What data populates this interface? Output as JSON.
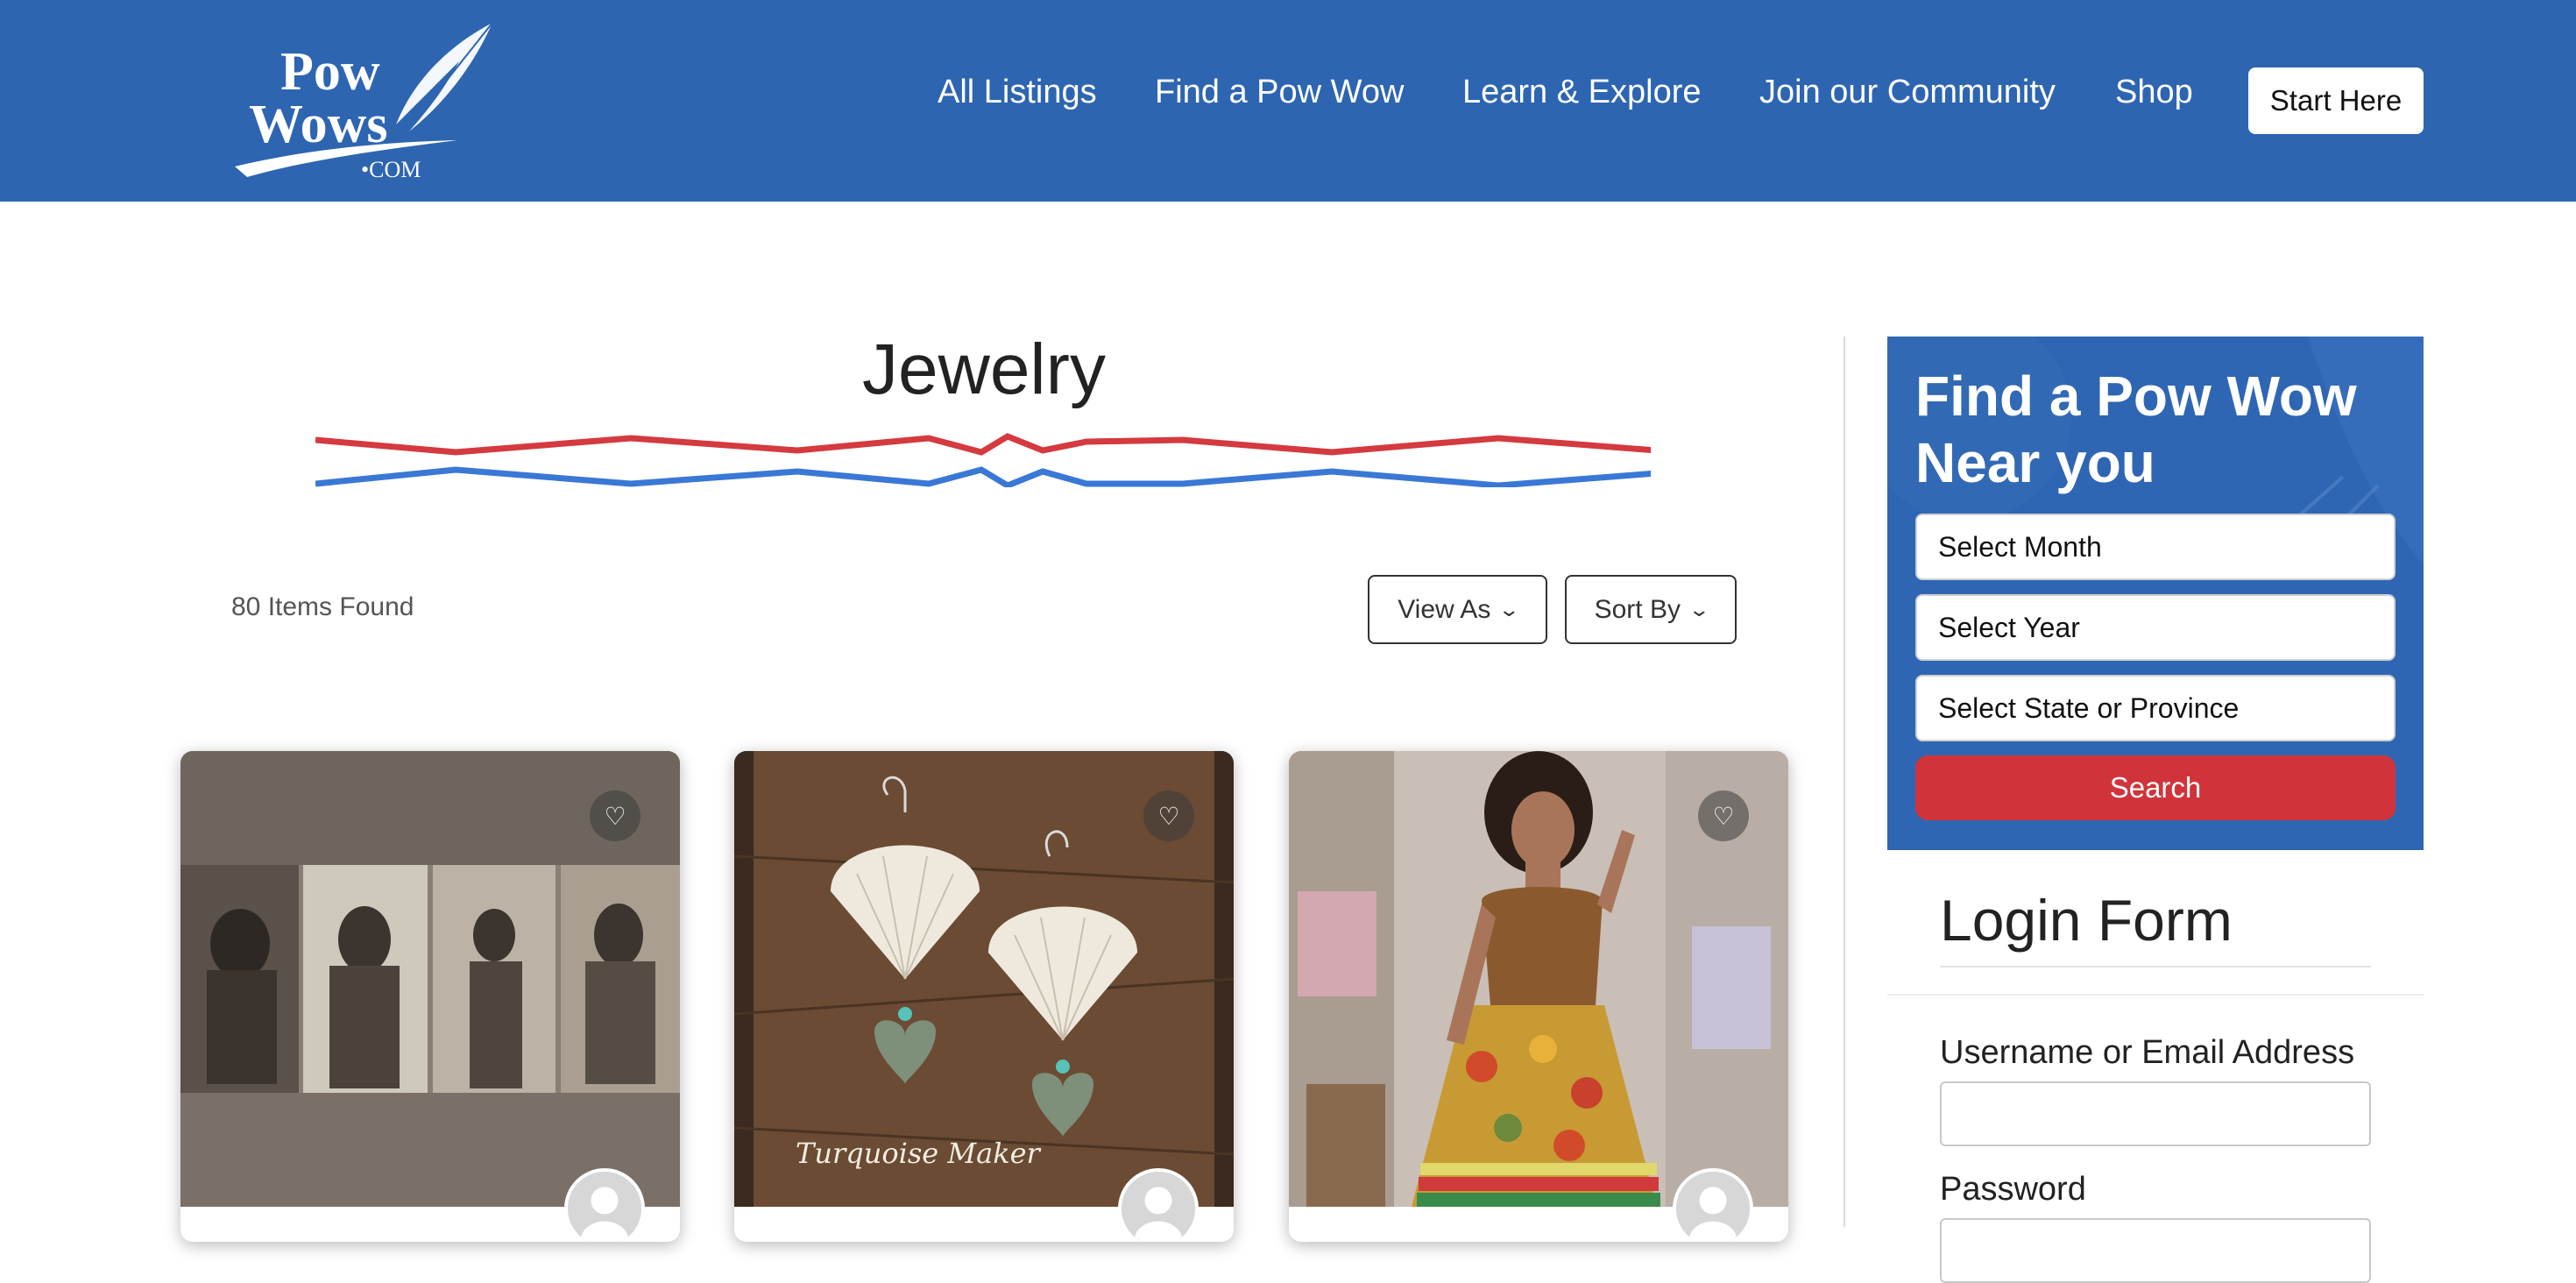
{
  "header": {
    "logo_text": "Pow Wows .com",
    "nav": [
      "All Listings",
      "Find a Pow Wow",
      "Learn & Explore",
      "Join our Community",
      "Shop"
    ],
    "start_button": "Start Here"
  },
  "main": {
    "title": "Jewelry",
    "items_found": "80 Items Found",
    "view_as": "View As",
    "sort_by": "Sort By",
    "cards": [
      {
        "name": "Card 1 - historical portraits"
      },
      {
        "name": "Card 2 - shell earrings",
        "watermark": "Turquoise Maker"
      },
      {
        "name": "Card 3 - ribbon skirt"
      }
    ]
  },
  "sidebar": {
    "finder_title": "Find a Pow Wow Near you",
    "select_month": "Select Month",
    "select_year": "Select Year",
    "select_state": "Select State or Province",
    "search": "Search",
    "login_title": "Login Form",
    "username_label": "Username or Email Address",
    "password_label": "Password"
  },
  "colors": {
    "header_blue": "#2d65b1",
    "search_red": "#d0343a",
    "divider_red": "#d43a3f",
    "divider_blue": "#3a78d6"
  },
  "icons": [
    "heart-icon",
    "chevron-down-icon",
    "avatar-icon",
    "feather-icon"
  ]
}
